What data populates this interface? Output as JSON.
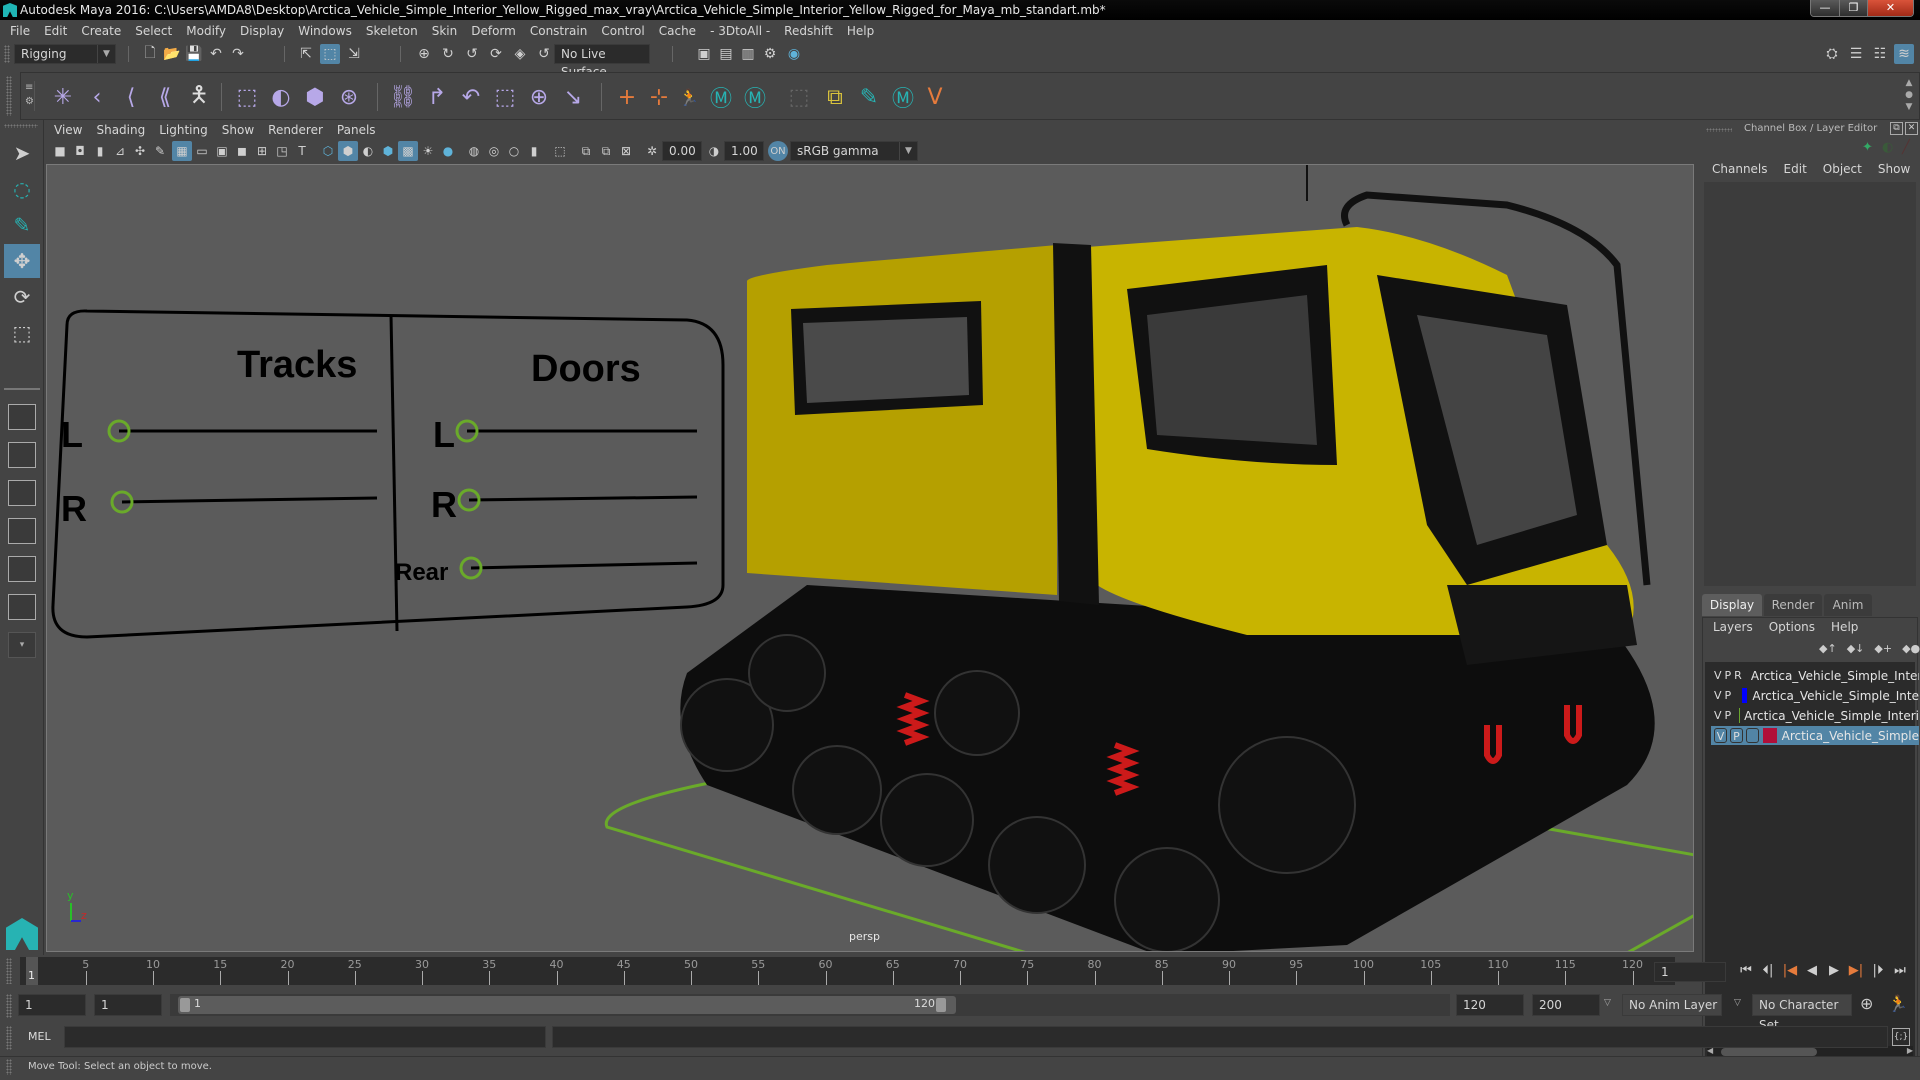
{
  "window": {
    "title": "Autodesk Maya 2016: C:\\Users\\AMDA8\\Desktop\\Arctica_Vehicle_Simple_Interior_Yellow_Rigged_max_vray\\Arctica_Vehicle_Simple_Interior_Yellow_Rigged_for_Maya_mb_standart.mb*",
    "minimize": "—",
    "restore": "❐",
    "close": "✕"
  },
  "menubar": [
    "File",
    "Edit",
    "Create",
    "Select",
    "Modify",
    "Display",
    "Windows",
    "Skeleton",
    "Skin",
    "Deform",
    "Constrain",
    "Control",
    "Cache",
    "- 3DtoAll -",
    "Redshift",
    "Help"
  ],
  "statusline": {
    "menuset": "Rigging",
    "live_surface": "No Live Surface"
  },
  "shelf": {
    "icons": [
      "joint-tool-icon",
      "ik-handle-icon",
      "ik-spline-icon",
      "insert-joint-icon",
      "humanik-icon",
      "bind-skin-icon",
      "paint-weights-icon",
      "lattice-icon",
      "cluster-icon",
      "parent-constraint-icon",
      "point-constraint-icon",
      "orient-constraint-icon",
      "scale-constraint-icon",
      "aim-constraint-icon",
      "pole-vector-icon",
      "locator-icon",
      "parent-icon",
      "character-icon",
      "maya-m-icon",
      "maya-m2-icon",
      "group-icon",
      "paint-select-icon",
      "maya-m3-icon",
      "v-icon"
    ]
  },
  "viewport": {
    "panel_menu": [
      "View",
      "Shading",
      "Lighting",
      "Show",
      "Renderer",
      "Panels"
    ],
    "exposure": "0.00",
    "gamma": "1.00",
    "color_space": "sRGB gamma",
    "camera_label": "persp",
    "axis": {
      "y": "y",
      "z": "z"
    },
    "rig_ui": {
      "tracks_title": "Tracks",
      "doors_title": "Doors",
      "tracks_rows": [
        "L",
        "R"
      ],
      "doors_rows": [
        "L",
        "R",
        "Rear"
      ]
    },
    "colors": {
      "background": "#5b5b5b",
      "body_yellow": "#c8b400",
      "control_green": "#6aaa2a",
      "spring_red": "#cc1a1a"
    }
  },
  "channel_box": {
    "title": "Channel Box / Layer Editor",
    "menu": [
      "Channels",
      "Edit",
      "Object",
      "Show"
    ]
  },
  "layer_editor": {
    "tabs": [
      "Display",
      "Render",
      "Anim"
    ],
    "active_tab": "Display",
    "menu": [
      "Layers",
      "Options",
      "Help"
    ],
    "layers": [
      {
        "v": "V",
        "p": "P",
        "r": "R",
        "color": "#0e4a1c",
        "name": "Arctica_Vehicle_Simple_Interi"
      },
      {
        "v": "V",
        "p": "P",
        "r": "",
        "color": "#0000ff",
        "name": "Arctica_Vehicle_Simple_Inte"
      },
      {
        "v": "V",
        "p": "P",
        "r": "",
        "color": "#6aa52e",
        "name": "Arctica_Vehicle_Simple_Interi"
      },
      {
        "v": "V",
        "p": "P",
        "r": "",
        "color": "#b0103a",
        "name": "Arctica_Vehicle_Simple",
        "selected": true
      }
    ]
  },
  "timeline": {
    "ticks": [
      "5",
      "10",
      "15",
      "20",
      "25",
      "30",
      "35",
      "40",
      "45",
      "50",
      "55",
      "60",
      "65",
      "70",
      "75",
      "80",
      "85",
      "90",
      "95",
      "100",
      "105",
      "110",
      "115",
      "120"
    ],
    "current_frame_marker": "1",
    "current_frame": "1"
  },
  "range": {
    "start": "1",
    "anim_start": "1",
    "range_start": "1",
    "range_end": "120",
    "playback_end": "120",
    "anim_end": "200",
    "anim_layer": "No Anim Layer",
    "character_set": "No Character Set"
  },
  "command": {
    "label": "MEL",
    "value": "",
    "result": ""
  },
  "help_line": "Move Tool: Select an object to move."
}
